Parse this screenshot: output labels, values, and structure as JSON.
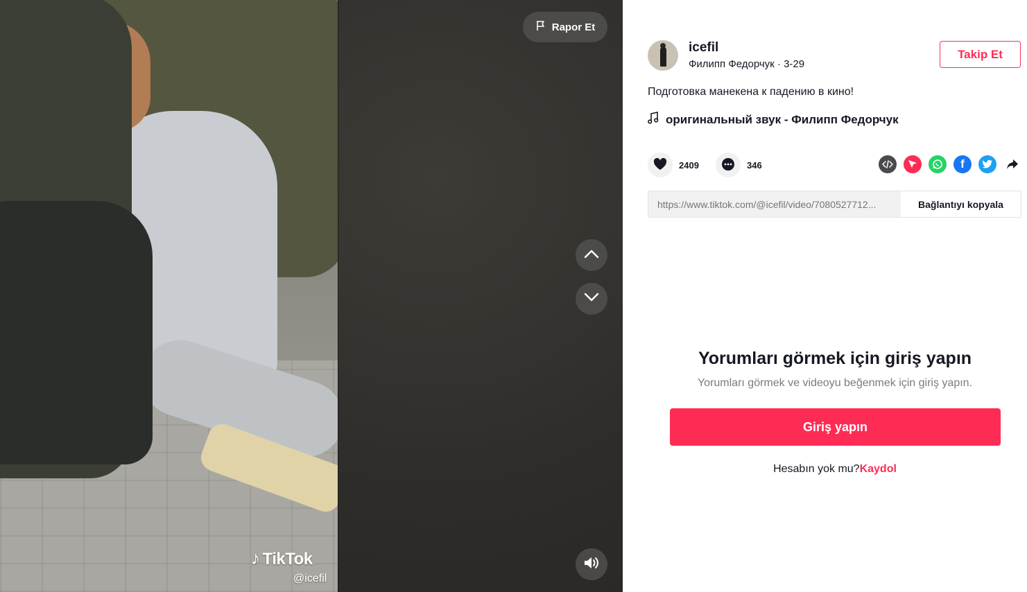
{
  "video": {
    "report_label": "Rapor Et",
    "watermark_brand": "TikTok",
    "watermark_handle": "@icefil"
  },
  "author": {
    "username": "icefil",
    "display_name": "Филипп Федорчук",
    "date": "3-29",
    "follow_label": "Takip Et"
  },
  "post": {
    "description": "Подготовка манекена к падению в кино!",
    "music": "оригинальный звук - Филипп Федорчук",
    "likes": "2409",
    "comments": "346",
    "link": "https://www.tiktok.com/@icefil/video/7080527712...",
    "copy_link_label": "Bağlantıyı kopyala"
  },
  "share_icons": [
    "embed-icon",
    "send-icon",
    "whatsapp-icon",
    "facebook-icon",
    "twitter-icon",
    "share-arrow-icon"
  ],
  "login": {
    "title": "Yorumları görmek için giriş yapın",
    "subtitle": "Yorumları görmek ve videoyu beğenmek için giriş yapın.",
    "button_label": "Giriş yapın",
    "signup_prompt": "Hesabın yok mu?",
    "signup_link": "Kaydol"
  },
  "colors": {
    "brand": "#fe2c55",
    "text": "#161823",
    "whatsapp": "#25d366",
    "facebook": "#1877f2",
    "twitter": "#1da1f2"
  }
}
